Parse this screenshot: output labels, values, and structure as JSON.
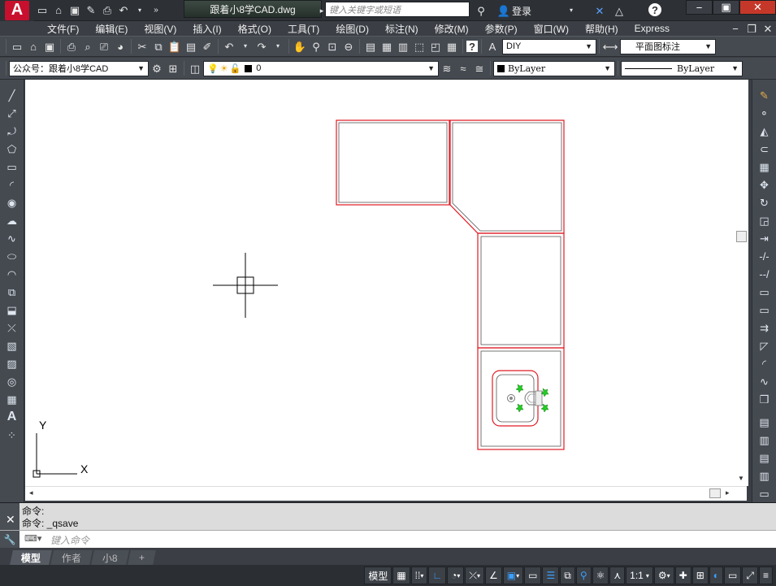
{
  "app": {
    "doc_title": "跟着小8学CAD.dwg",
    "search_placeholder": "键入关键字或短语",
    "login_label": "登录",
    "window_buttons": [
      "−",
      "▣",
      "✕"
    ],
    "window_buttons2": [
      "−",
      "❐",
      "✕"
    ]
  },
  "menu": [
    "文件(F)",
    "编辑(E)",
    "视图(V)",
    "插入(I)",
    "格式(O)",
    "工具(T)",
    "绘图(D)",
    "标注(N)",
    "修改(M)",
    "参数(P)",
    "窗口(W)",
    "帮助(H)",
    "Express"
  ],
  "toolbar1": {
    "text_style": "DIY",
    "dim_style": "平面图标注"
  },
  "toolbar2": {
    "workspace": "公众号：跟着小8学CAD",
    "layer": "0",
    "color": "ByLayer",
    "linetype": "ByLayer"
  },
  "ucs": {
    "x": "X",
    "y": "Y"
  },
  "command": {
    "history": [
      "命令:",
      "命令: _qsave"
    ],
    "placeholder": "键入命令"
  },
  "tabs": [
    "模型",
    "作者",
    "小8",
    "+"
  ],
  "status": {
    "model": "模型",
    "scale": "1:1"
  },
  "colors": {
    "drawing_red": "#e01b24",
    "grip_green": "#22cc22",
    "canvas_bg": "#ffffff"
  }
}
